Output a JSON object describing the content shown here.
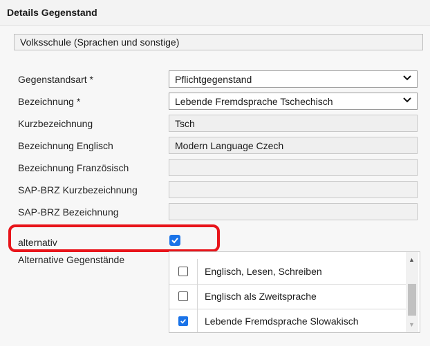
{
  "panel": {
    "title": "Details Gegenstand"
  },
  "school": {
    "value": "Volksschule (Sprachen und sonstige)"
  },
  "form": {
    "gegenstandsart": {
      "label": "Gegenstandsart *",
      "value": "Pflichtgegenstand"
    },
    "bezeichnung": {
      "label": "Bezeichnung *",
      "value": "Lebende Fremdsprache Tschechisch"
    },
    "kurzbezeichnung": {
      "label": "Kurzbezeichnung",
      "value": "Tsch"
    },
    "bezeichnung_englisch": {
      "label": "Bezeichnung Englisch",
      "value": "Modern Language Czech"
    },
    "bezeichnung_franzoesisch": {
      "label": "Bezeichnung Französisch",
      "value": ""
    },
    "sap_kurz": {
      "label": "SAP-BRZ Kurzbezeichnung",
      "value": ""
    },
    "sap_bez": {
      "label": "SAP-BRZ Bezeichnung",
      "value": ""
    },
    "alternativ": {
      "label": "alternativ",
      "checked": true
    }
  },
  "alternatives": {
    "label": "Alternative Gegenstände",
    "items": [
      {
        "label": "Englisch, Lesen, Schreiben",
        "checked": false
      },
      {
        "label": "Englisch als Zweitsprache",
        "checked": false
      },
      {
        "label": "Lebende Fremdsprache Slowakisch",
        "checked": true
      }
    ]
  },
  "colors": {
    "accent": "#1a73e8",
    "highlight": "#e8141a"
  }
}
